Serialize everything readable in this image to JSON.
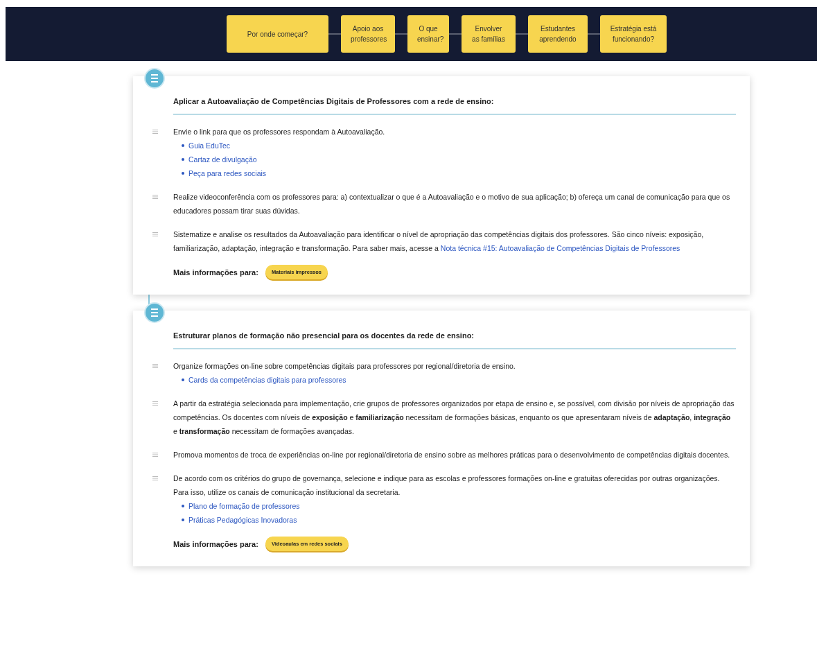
{
  "nav": {
    "buttons": [
      {
        "label": "Por onde começar?"
      },
      {
        "label": "Apoio aos professores"
      },
      {
        "label": "O que ensinar?"
      },
      {
        "label": "Envolver as famílias"
      },
      {
        "label": "Estudantes aprendendo"
      },
      {
        "label": "Estratégia está funcionando?"
      }
    ]
  },
  "cards": [
    {
      "title": "Aplicar a Autoavaliação de Competências Digitais de Professores com a rede de ensino:",
      "items": [
        {
          "text": "Envie o link para que os professores respondam à Autoavaliação.",
          "links": [
            "Guia EduTec",
            "Cartaz de divulgação",
            "Peça para redes sociais"
          ]
        },
        {
          "text": "Realize videoconferência com os professores para: a) contextualizar o que é a Autoavaliação e o motivo de sua aplicação; b) ofereça um canal de comunicação para que os educadores possam tirar suas dúvidas."
        },
        {
          "text": "Sistematize e analise os resultados da Autoavaliação para identificar o nível de apropriação das competências digitais dos professores. São cinco níveis: exposição, familiarização, adaptação, integração e transformação. Para saber mais, acesse a",
          "inline_link": "Nota técnica #15: Autoavaliação de Competências Digitais de Professores"
        }
      ],
      "more_label": "Mais informações para:",
      "more_tag": "Materiais impressos"
    },
    {
      "title": "Estruturar planos de formação não presencial para os docentes da rede de ensino:",
      "items": [
        {
          "text": "Organize formações on-line sobre competências digitais para professores por regional/diretoria de ensino.",
          "links": [
            "Cards da competências digitais para professores"
          ]
        },
        {
          "text": "A partir da estratégia selecionada para implementação, crie grupos de professores organizados por etapa de ensino e, se possível, com divisão por níveis de apropriação das competências. Os docentes com níveis de **exposição** e **familiarização** necessitam de formações básicas, enquanto os que apresentaram níveis de **adaptação**, **integração** e **transformação** necessitam de formações avançadas."
        },
        {
          "text": "Promova momentos de troca de experiências on-line por regional/diretoria de ensino sobre as melhores práticas para o desenvolvimento de competências digitais docentes."
        },
        {
          "text": "De acordo com os critérios do grupo de governança, selecione e indique para as escolas e professores formações on-line e gratuitas oferecidas por outras organizações. Para isso, utilize os canais de comunicação institucional da secretaria.",
          "links": [
            "Plano de formação de professores",
            "Práticas Pedagógicas Inovadoras"
          ]
        }
      ],
      "more_label": "Mais informações para:",
      "more_tag": "Videoaulas em redes sociais"
    }
  ]
}
